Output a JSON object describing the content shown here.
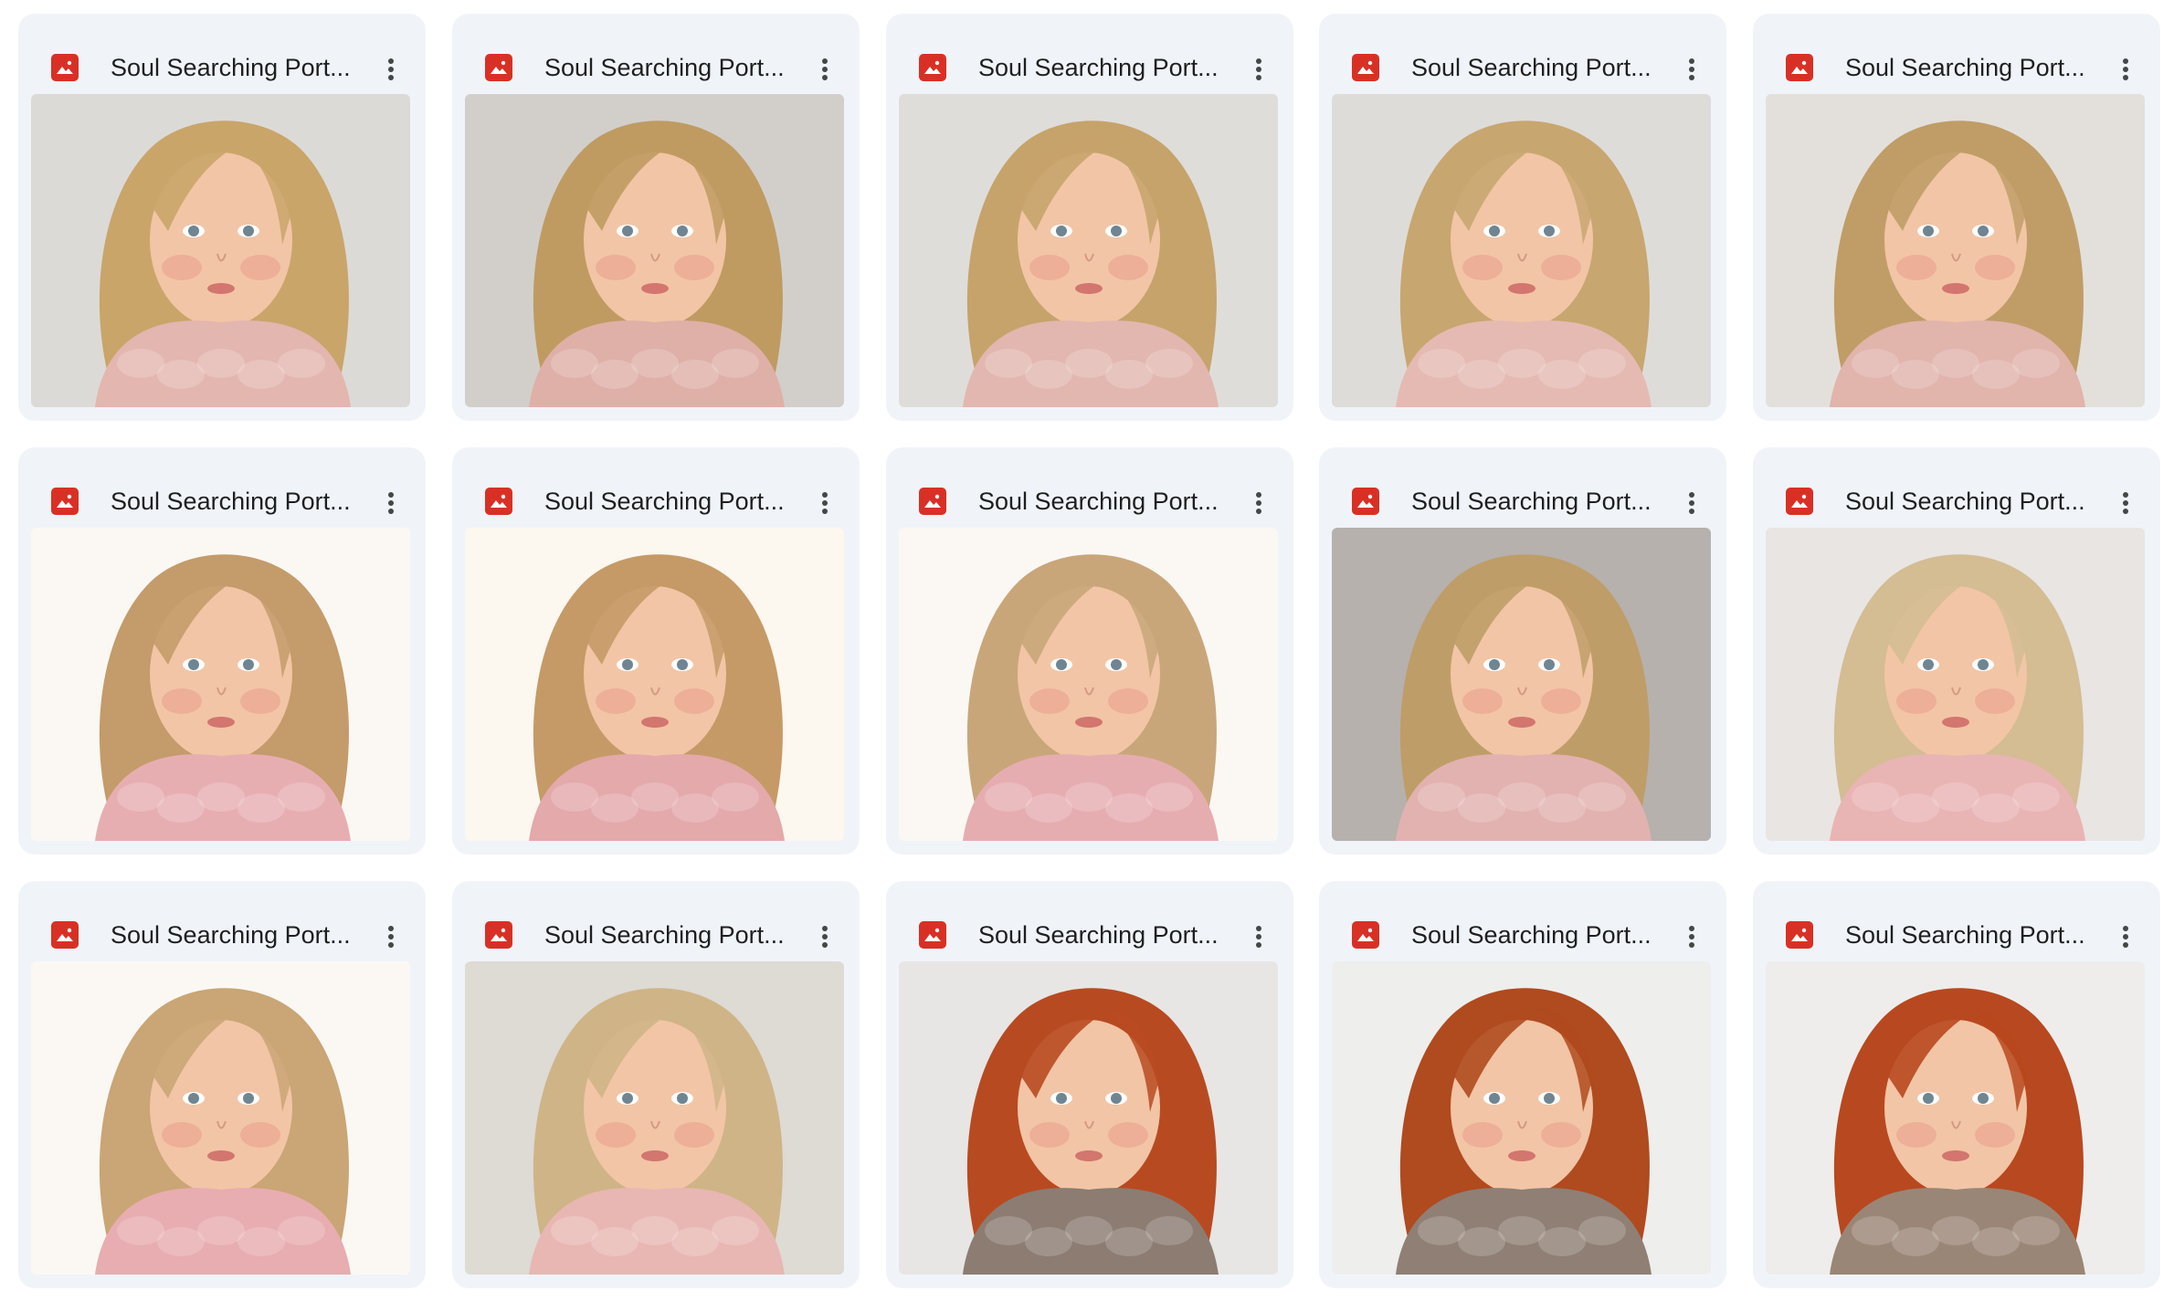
{
  "files": [
    {
      "title": "Soul Searching Port...",
      "icon": "image-file-icon",
      "bg": "#dcdad6",
      "hair": "#c9a56a",
      "scarf": "#e4b6b0"
    },
    {
      "title": "Soul Searching Port...",
      "icon": "image-file-icon",
      "bg": "#d2cfcb",
      "hair": "#bf9b62",
      "scarf": "#dfb0a8"
    },
    {
      "title": "Soul Searching Port...",
      "icon": "image-file-icon",
      "bg": "#dfddda",
      "hair": "#c6a36b",
      "scarf": "#e2b7af"
    },
    {
      "title": "Soul Searching Port...",
      "icon": "image-file-icon",
      "bg": "#dedcd9",
      "hair": "#c8a670",
      "scarf": "#e5bab2"
    },
    {
      "title": "Soul Searching Port...",
      "icon": "image-file-icon",
      "bg": "#e3e0db",
      "hair": "#c09d67",
      "scarf": "#e1b4ac"
    },
    {
      "title": "Soul Searching Port...",
      "icon": "image-file-icon",
      "bg": "#fbf8f4",
      "hair": "#c49b6a",
      "scarf": "#e7aeb2"
    },
    {
      "title": "Soul Searching Port...",
      "icon": "image-file-icon",
      "bg": "#fcf7ef",
      "hair": "#c59a67",
      "scarf": "#e3a9ab"
    },
    {
      "title": "Soul Searching Port...",
      "icon": "image-file-icon",
      "bg": "#fbf8f4",
      "hair": "#c9a67a",
      "scarf": "#e6adb1"
    },
    {
      "title": "Soul Searching Port...",
      "icon": "image-file-icon",
      "bg": "#b6b1ad",
      "hair": "#bf9d68",
      "scarf": "#e2b2b0"
    },
    {
      "title": "Soul Searching Port...",
      "icon": "image-file-icon",
      "bg": "#e8e5e3",
      "hair": "#d4bc93",
      "scarf": "#e9b4b4"
    },
    {
      "title": "Soul Searching Port...",
      "icon": "image-file-icon",
      "bg": "#fbf8f4",
      "hair": "#caa575",
      "scarf": "#e7adb0"
    },
    {
      "title": "Soul Searching Port...",
      "icon": "image-file-icon",
      "bg": "#dedad4",
      "hair": "#cfb487",
      "scarf": "#e8b7b3"
    },
    {
      "title": "Soul Searching Port...",
      "icon": "image-file-icon",
      "bg": "#e7e6e4",
      "hair": "#b84a21",
      "scarf": "#8c7c72"
    },
    {
      "title": "Soul Searching Port...",
      "icon": "image-file-icon",
      "bg": "#eeeeec",
      "hair": "#b04a1f",
      "scarf": "#8f7f75"
    },
    {
      "title": "Soul Searching Port...",
      "icon": "image-file-icon",
      "bg": "#eeedec",
      "hair": "#b8481f",
      "scarf": "#9a8676"
    }
  ]
}
